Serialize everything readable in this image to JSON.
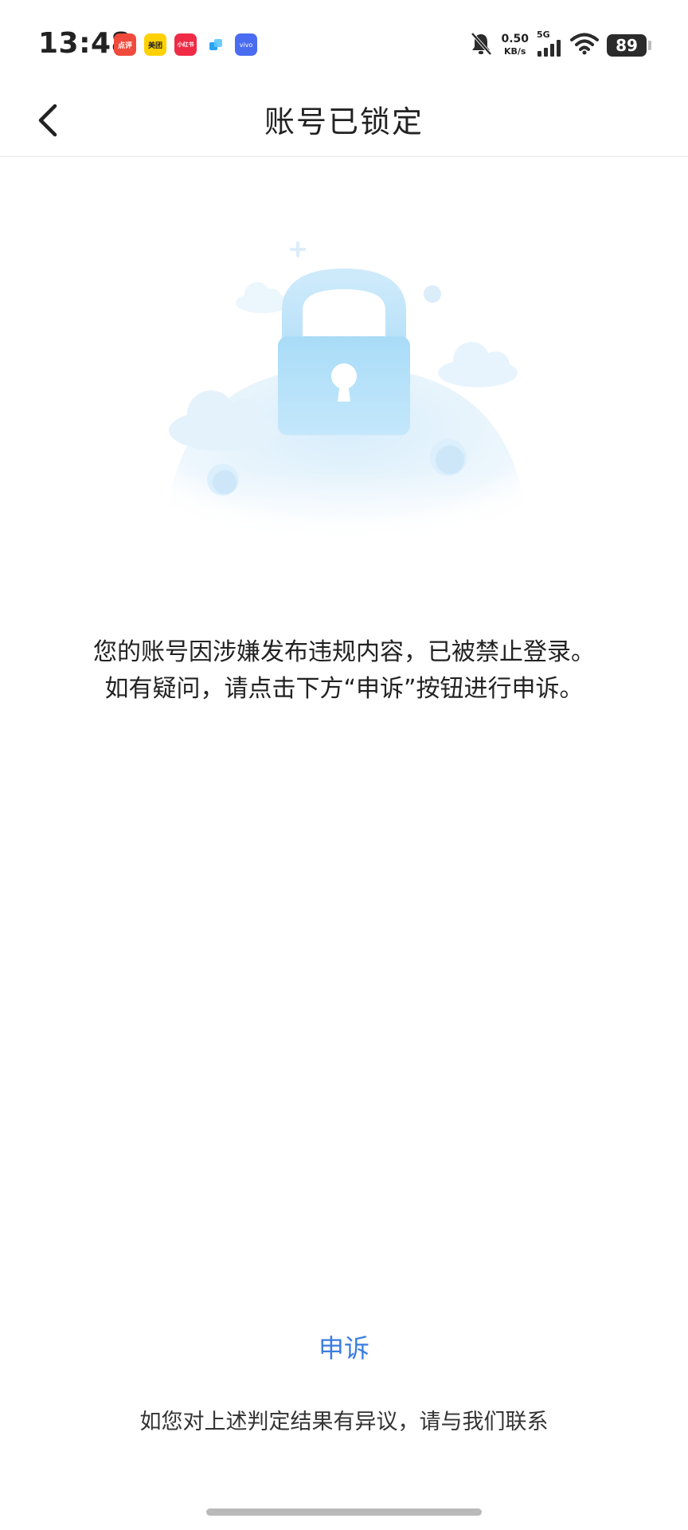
{
  "status_bar": {
    "time": "13:48",
    "apps": [
      {
        "icon": "dianping-app-icon",
        "label": "点评",
        "color": "#f04a3c"
      },
      {
        "icon": "meituan-app-icon",
        "label": "美团",
        "color": "#ffd100"
      },
      {
        "icon": "xiaohongshu-app-icon",
        "label": "小红书",
        "color": "#ef2b46"
      },
      {
        "icon": "blue-app-icon",
        "label": "",
        "color": "#ffffff"
      },
      {
        "icon": "vivo-app-icon",
        "label": "vivo",
        "color": "#4a6cf0"
      }
    ],
    "net_speed_value": "0.50",
    "net_speed_unit": "KB/s",
    "network_type": "5G",
    "battery_level": "89",
    "icons": [
      "bell-muted-icon",
      "signal-bars-icon",
      "wifi-icon",
      "battery-icon"
    ]
  },
  "nav": {
    "title": "账号已锁定",
    "back_icon": "chevron-left-icon"
  },
  "illustration": {
    "icon": "locked-padlock-illustration",
    "accent_color": "#aee0fb"
  },
  "message": {
    "line1": "您的账号因涉嫌发布违规内容，已被禁止登录。",
    "line2": "如有疑问，请点击下方“申诉”按钮进行申诉。"
  },
  "appeal": {
    "label": "申诉",
    "color": "#3b7de0"
  },
  "contact": {
    "text": "如您对上述判定结果有异议，请与我们联系"
  }
}
